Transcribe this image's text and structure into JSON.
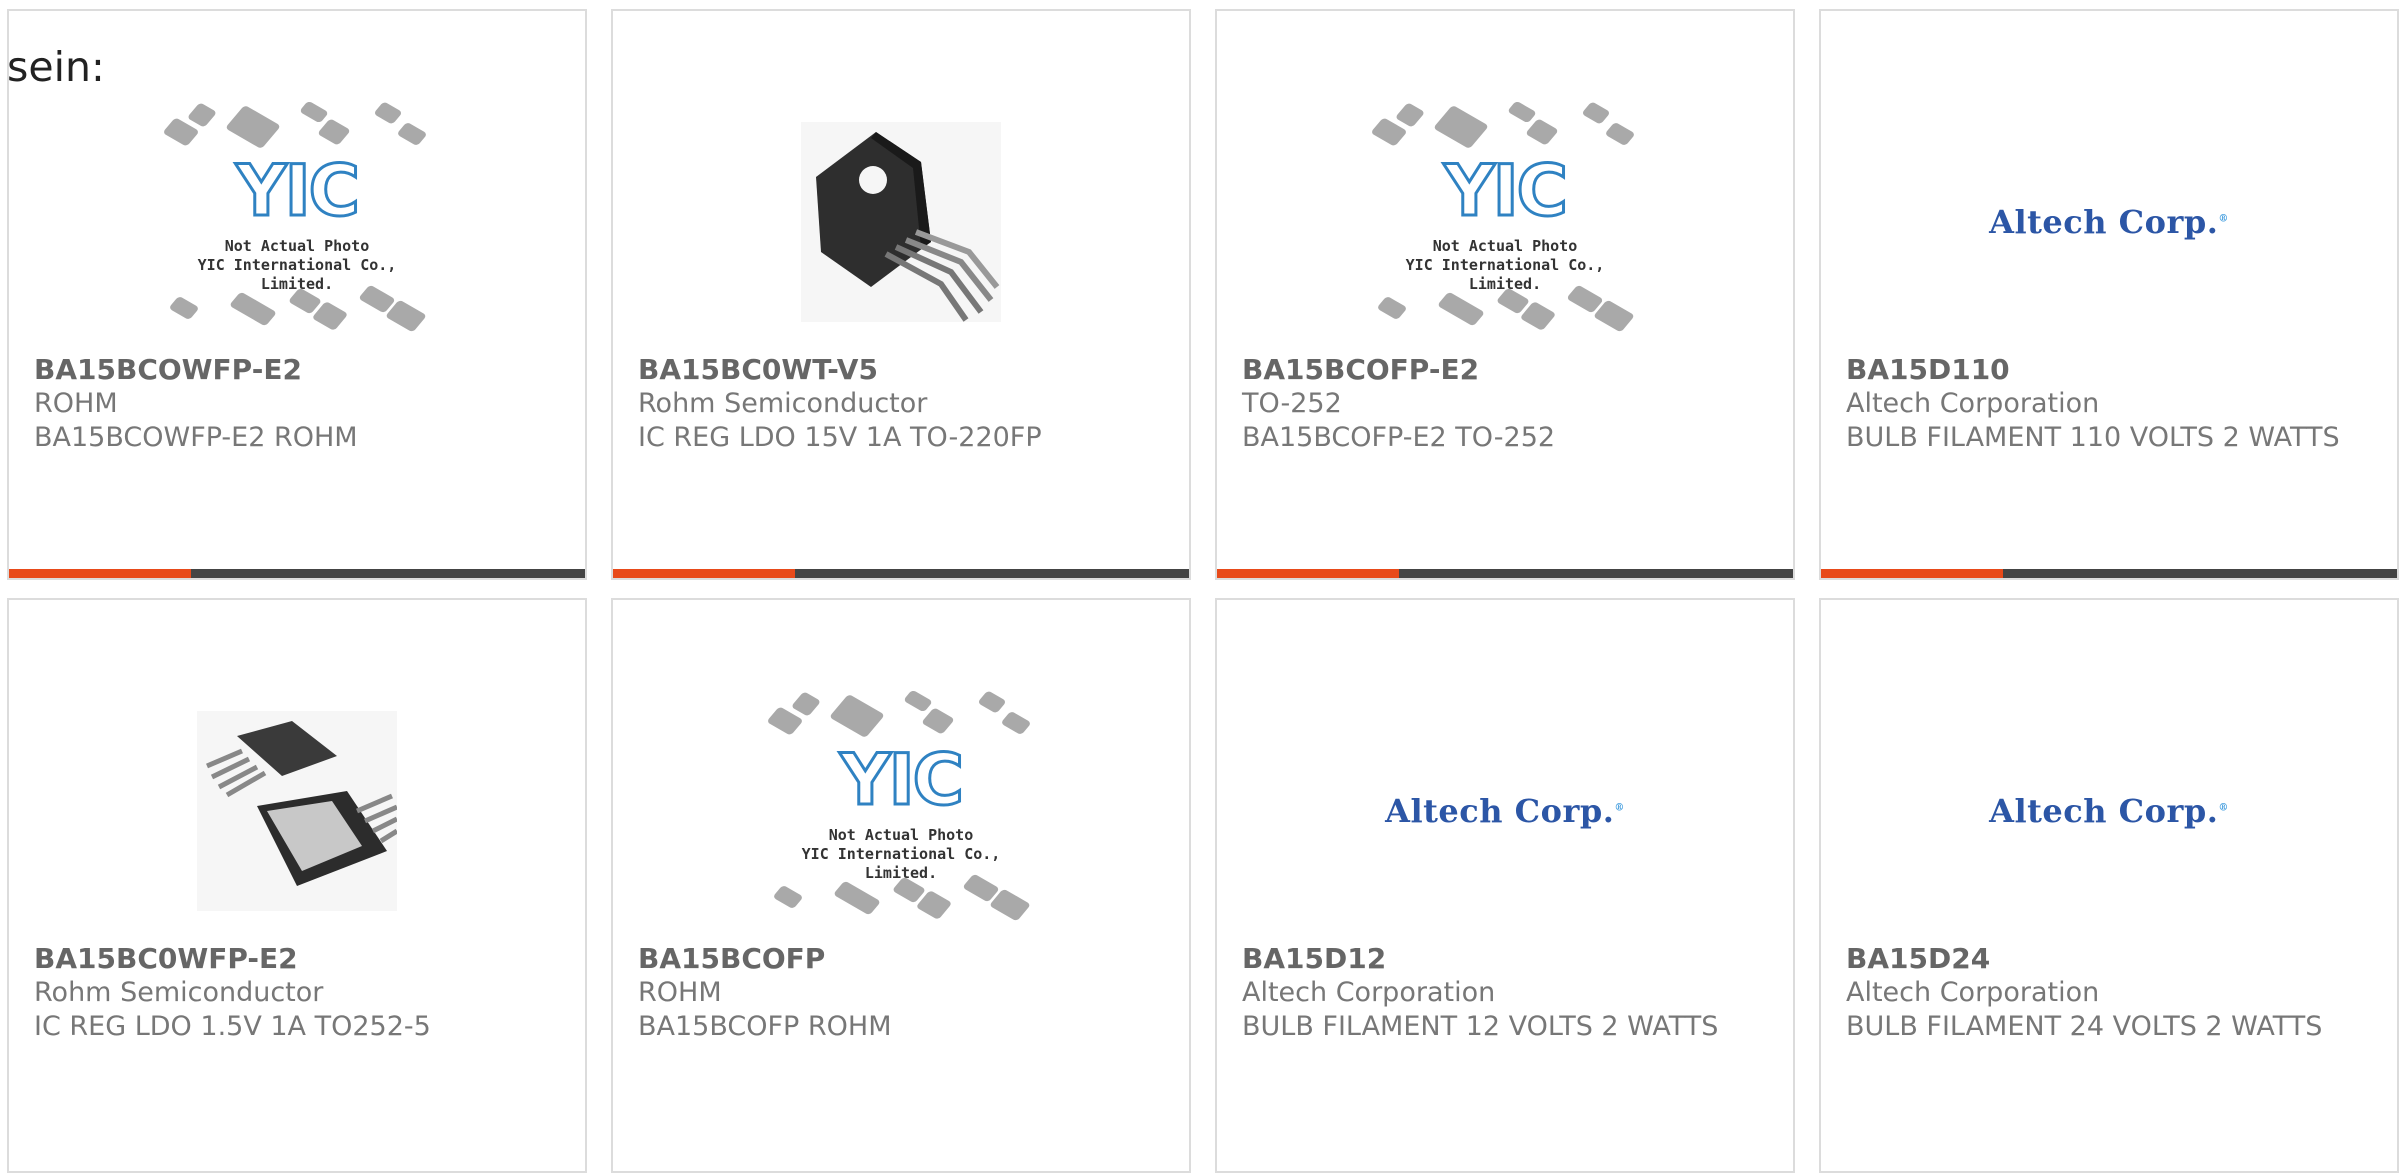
{
  "intro_text": "sein:",
  "yic_logo_text": "YIC",
  "yic_note_line1": "Not Actual Photo",
  "yic_note_line2": "YIC International Co., Limited.",
  "altech_logo_text": "Altech Corp.",
  "accent_color": "#e84a1a",
  "products": [
    {
      "part": "BA15BCOWFP-E2",
      "mfr": "ROHM",
      "desc": "BA15BCOWFP-E2 ROHM",
      "image": "yic-placeholder"
    },
    {
      "part": "BA15BC0WT-V5",
      "mfr": "Rohm Semiconductor",
      "desc": "IC REG LDO 15V 1A TO-220FP",
      "image": "to220fp-package"
    },
    {
      "part": "BA15BCOFP-E2",
      "mfr": "TO-252",
      "desc": "BA15BCOFP-E2 TO-252",
      "image": "yic-placeholder"
    },
    {
      "part": "BA15D110",
      "mfr": "Altech Corporation",
      "desc": "BULB FILAMENT 110 VOLTS 2 WATTS",
      "image": "altech-logo"
    },
    {
      "part": "BA15BC0WFP-E2",
      "mfr": "Rohm Semiconductor",
      "desc": "IC REG LDO 1.5V 1A TO252-5",
      "image": "to252-package"
    },
    {
      "part": "BA15BCOFP",
      "mfr": "ROHM",
      "desc": "BA15BCOFP ROHM",
      "image": "yic-placeholder"
    },
    {
      "part": "BA15D12",
      "mfr": "Altech Corporation",
      "desc": "BULB FILAMENT 12 VOLTS 2 WATTS",
      "image": "altech-logo"
    },
    {
      "part": "BA15D24",
      "mfr": "Altech Corporation",
      "desc": "BULB FILAMENT 24 VOLTS 2 WATTS",
      "image": "altech-logo"
    }
  ]
}
